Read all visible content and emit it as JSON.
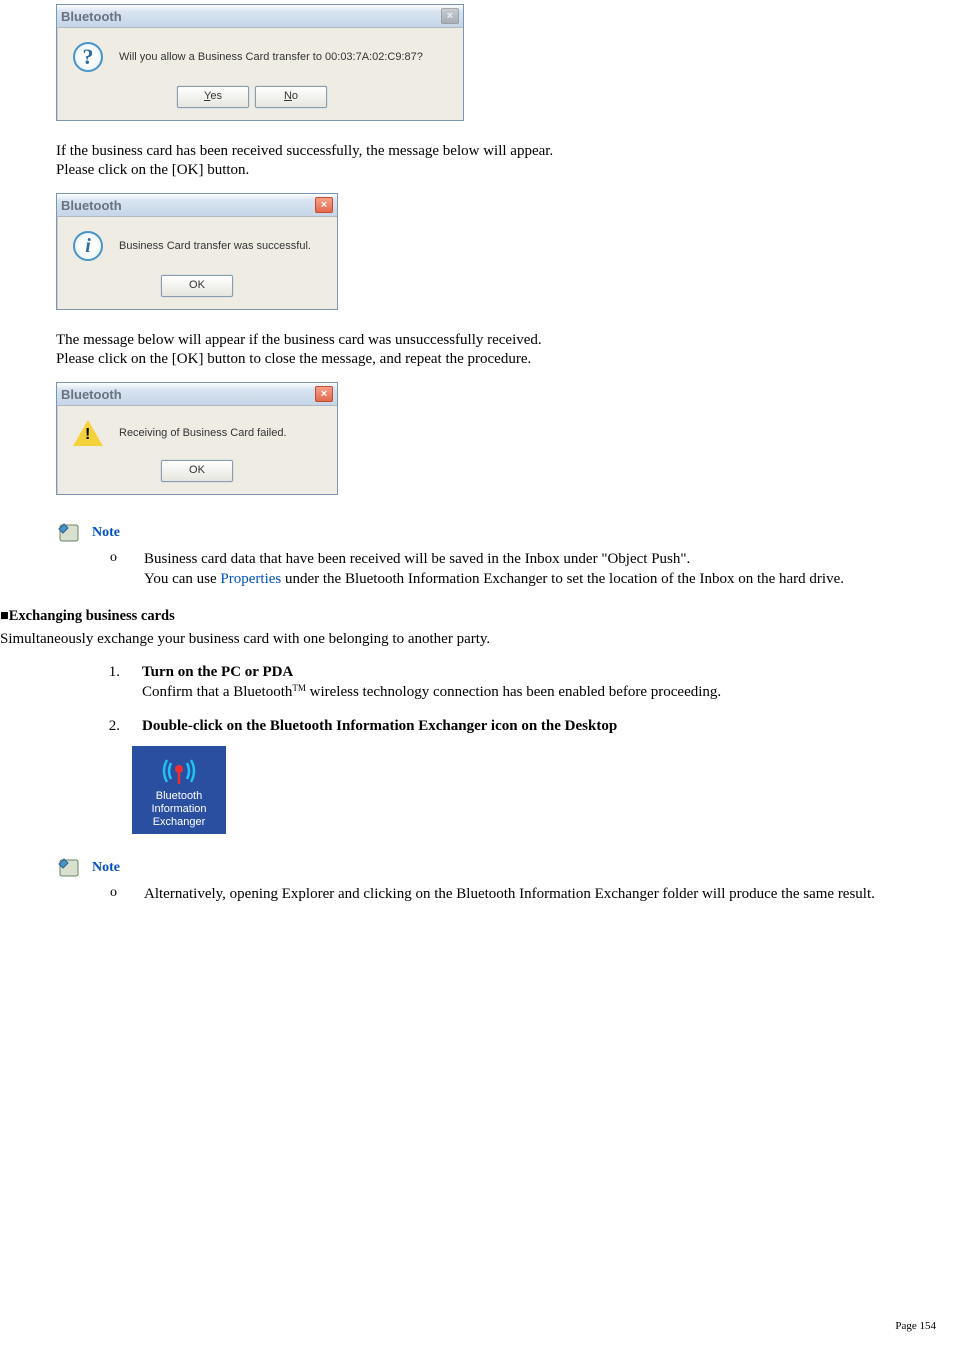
{
  "dialog1": {
    "title": "Bluetooth",
    "message": "Will you allow a Business Card transfer to 00:03:7A:02:C9:87?",
    "yes": "Yes",
    "no": "No"
  },
  "para1a": "If the business card has been received successfully, the message below will appear.",
  "para1b": "Please click on the [OK] button.",
  "dialog2": {
    "title": "Bluetooth",
    "message": "Business Card transfer was successful.",
    "ok": "OK"
  },
  "para2a": "The message below will appear if the business card was unsuccessfully received.",
  "para2b": "Please click on the [OK] button to close the message, and repeat the procedure.",
  "dialog3": {
    "title": "Bluetooth",
    "message": "Receiving of Business Card failed.",
    "ok": "OK"
  },
  "note_label": "Note",
  "note1_line1": "Business card data that have been received will be saved in the Inbox under \"Object Push\".",
  "note1_line2a": "You can use ",
  "note1_link": "Properties",
  "note1_line2b": " under the Bluetooth Information Exchanger to set the location of the Inbox on the hard drive.",
  "section_heading": "■Exchanging business cards",
  "section_intro": "Simultaneously exchange your business card with one belonging to another party.",
  "step1_title": "Turn on the PC or PDA",
  "step1_body_a": "Confirm that a Bluetooth",
  "step1_body_tm": "TM",
  "step1_body_b": " wireless technology connection has been enabled before proceeding.",
  "step2_title": "Double-click on the Bluetooth Information Exchanger icon on the Desktop",
  "desktop_icon_label": "Bluetooth Information Exchanger",
  "note2_line": "Alternatively, opening Explorer and clicking on the Bluetooth Information Exchanger folder will produce the same result.",
  "page_label": "Page 154",
  "bullet_marker": "o",
  "num1": "1.",
  "num2": "2."
}
